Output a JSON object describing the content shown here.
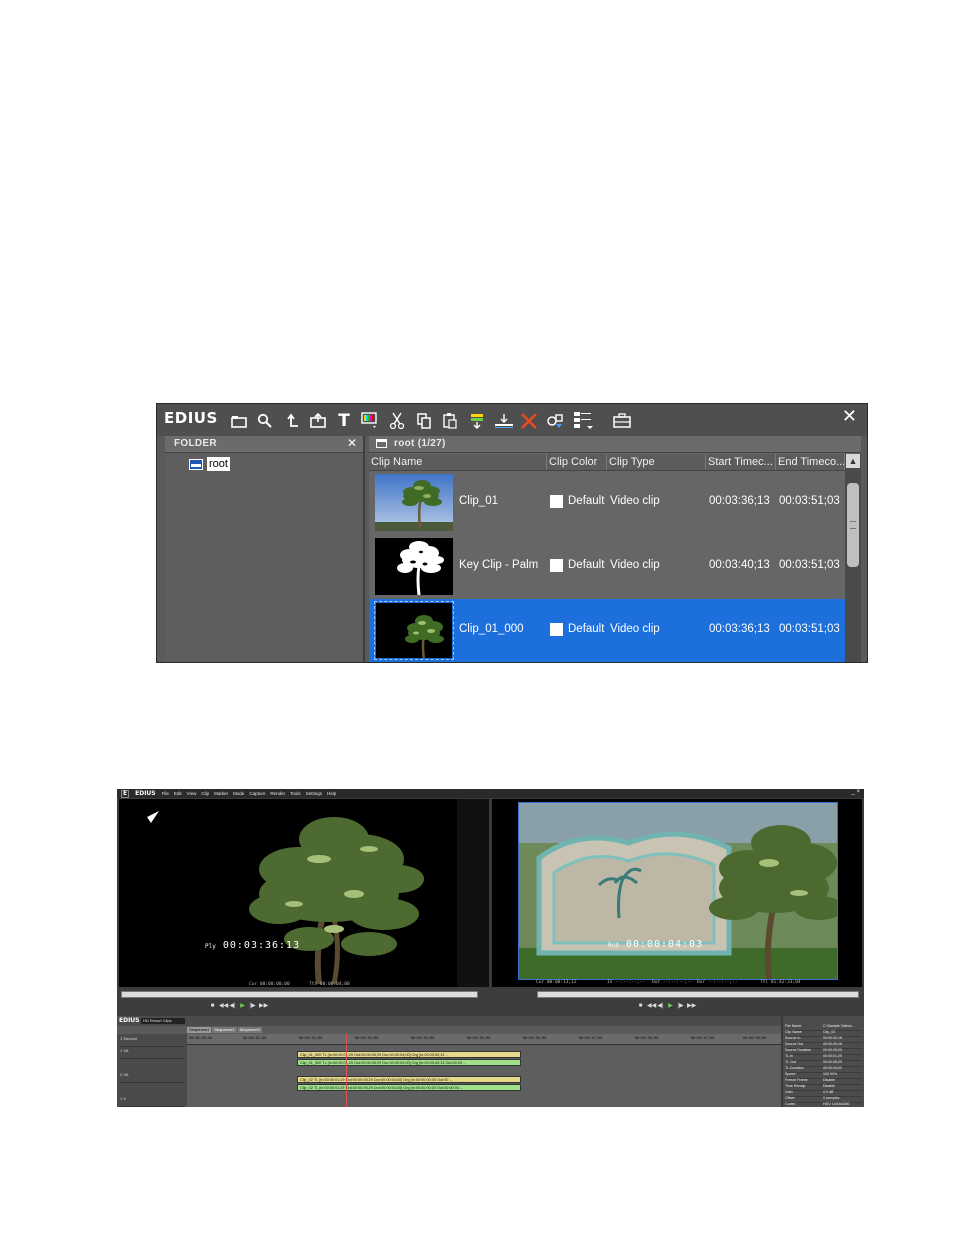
{
  "bin": {
    "logo": "EDIUS",
    "toolbar_icons": [
      "new-folder-icon",
      "search-icon",
      "up-folder-icon",
      "add-clip-icon",
      "title-icon",
      "color-bar-icon",
      "cut-icon",
      "copy-icon",
      "paste-icon",
      "add-to-timeline-icon",
      "insert-icon",
      "delete-icon",
      "properties-icon",
      "view-mode-icon",
      "open-bin-icon"
    ],
    "close_glyph": "✕",
    "folder_panel": {
      "title": "FOLDER",
      "close_glyph": "✕",
      "tree": [
        {
          "label": "root"
        }
      ]
    },
    "clip_panel": {
      "path": "root (1/27)",
      "columns": [
        "Clip Name",
        "Clip Color",
        "Clip Type",
        "Start Timec...",
        "End Timeco..."
      ],
      "rows": [
        {
          "name": "Clip_01",
          "color": "Default",
          "type": "Video clip",
          "start": "00:03:36;13",
          "end": "00:03:51;03",
          "selected": false
        },
        {
          "name": "Key Clip - Palm",
          "color": "Default",
          "type": "Video clip",
          "start": "00:03:40;13",
          "end": "00:03:51;03",
          "selected": false
        },
        {
          "name": "Clip_01_000",
          "color": "Default",
          "type": "Video clip",
          "start": "00:03:36;13",
          "end": "00:03:51;03",
          "selected": true
        }
      ]
    },
    "selection_color": "#1d6fdb"
  },
  "app": {
    "logo": "E",
    "name": "EDIUS",
    "menu": [
      "File",
      "Edit",
      "View",
      "Clip",
      "Marker",
      "Mode",
      "Capture",
      "Render",
      "Tools",
      "Settings",
      "Help"
    ],
    "window_controls": "_ ×",
    "player": {
      "timecode_label": "Ply",
      "timecode": "00:03:36:13",
      "cur_label": "Cur",
      "cur": "00:00:00;00",
      "ttl_label": "Ttl",
      "ttl": "00:00:04;00"
    },
    "recorder": {
      "timecode_label": "Rcd",
      "timecode": "00:00:04:03",
      "cur": "Cur 00:00:13;12",
      "in": "In --:--:--;--",
      "out": "Out --:--:--;--",
      "dur": "Dur --:--:--;--",
      "ttl": "Ttl 01:42:23;04"
    },
    "timeline": {
      "logo": "EDIUS",
      "project": "HD Resort Clips",
      "sequences": [
        "Sequence1",
        "Sequence2",
        "Sequence3"
      ],
      "ruler": [
        "00:00:00;00",
        "00:00:01;00",
        "00:00:02;00",
        "00:00:03;00",
        "00:00:04;00",
        "00:00:05;00",
        "00:00:06;00",
        "00:00:07;00",
        "00:00:08;00",
        "00:00:09;00",
        "00:00:07;00",
        "00:00:08;00"
      ],
      "track_labels": [
        "1 Second",
        "1 VA",
        "2 VA",
        "1 V"
      ],
      "clips": [
        {
          "label": "Clip_01_000  TL [In:00:00:01;29 Out:00:00:05;29 Dur:00:00:04;00]  Org [In:00:03:40;13 ...",
          "kind": "v"
        },
        {
          "label": "Clip_01_000  TL [In:00:00:01;29 Out:00:00:05;29 Dur:00:00:04;00]  Org [In:00:03:40;13 Out:00:03 ...",
          "kind": "a"
        },
        {
          "label": "Clip_02  TL [In:00:00:01;29 Out:00:00:05;29 Dur:00:00:04;00]  Org [In:00:00:00;00 Out:00 ...",
          "kind": "v"
        },
        {
          "label": "Clip_02  TL [In:00:00:01;29 Out:00:00:05;29 Dur:00:00:04;00]  Org [In:00:00:00;00 Out:00:00:04 ...",
          "kind": "a"
        }
      ]
    },
    "info_panel": [
      {
        "k": "File Name",
        "v": "C:\\Sample Videos..."
      },
      {
        "k": "Clip Name",
        "v": "Clip_02"
      },
      {
        "k": "Source In",
        "v": "00:00:00;16"
      },
      {
        "k": "Source Out",
        "v": "00:00:05;16"
      },
      {
        "k": "Source Duration",
        "v": "00:00:05;00"
      },
      {
        "k": "TL In",
        "v": "00:00:01;29"
      },
      {
        "k": "TL Out",
        "v": "00:00:05;29"
      },
      {
        "k": "TL Duration",
        "v": "00:00:04;00"
      },
      {
        "k": "Speed",
        "v": "100.00%"
      },
      {
        "k": "Freeze Frame",
        "v": "Disable"
      },
      {
        "k": "Time Remap",
        "v": "Disable"
      },
      {
        "k": "Gain",
        "v": "0.0 dB"
      },
      {
        "k": "Offset",
        "v": "0 samples"
      },
      {
        "k": "Codec",
        "v": "HDV 1440x1080"
      }
    ]
  }
}
